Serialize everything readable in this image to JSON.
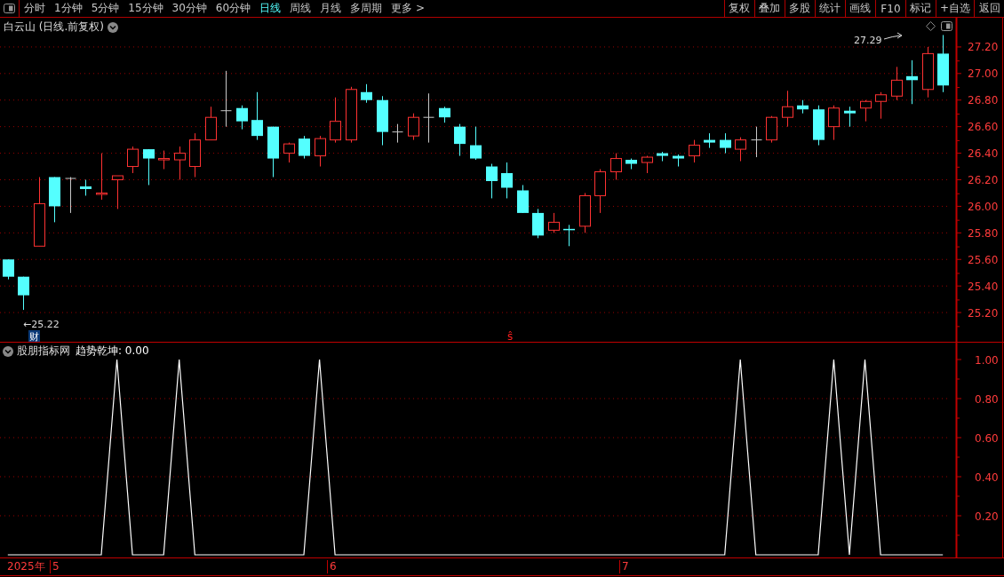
{
  "toolbar": {
    "periods": [
      {
        "label": "分时",
        "selected": false
      },
      {
        "label": "1分钟",
        "selected": false
      },
      {
        "label": "5分钟",
        "selected": false
      },
      {
        "label": "15分钟",
        "selected": false
      },
      {
        "label": "30分钟",
        "selected": false
      },
      {
        "label": "60分钟",
        "selected": false
      },
      {
        "label": "日线",
        "selected": true
      },
      {
        "label": "周线",
        "selected": false
      },
      {
        "label": "月线",
        "selected": false
      },
      {
        "label": "多周期",
        "selected": false
      },
      {
        "label": "更多 >",
        "selected": false
      }
    ],
    "buttons": [
      "复权",
      "叠加",
      "多股",
      "统计",
      "画线",
      "F10",
      "标记",
      "+自选",
      "返回"
    ]
  },
  "price_pane": {
    "title": "白云山 (日线.前复权)",
    "high_marker": "27.29",
    "low_marker": "←25.22",
    "finance_badge": "财",
    "signal_mark": "ŝ",
    "chart_data": {
      "type": "candlestick",
      "grid": true,
      "categories": [
        null,
        null,
        null,
        null,
        null,
        null,
        null,
        null,
        null,
        null,
        null,
        null,
        null,
        null,
        null,
        null,
        null,
        null,
        null,
        null,
        null,
        null,
        null,
        null,
        null,
        null,
        null,
        null,
        null,
        null,
        null,
        null,
        null,
        null,
        null,
        null,
        null,
        null,
        null,
        null,
        null,
        null,
        null,
        null,
        null,
        null,
        null,
        null,
        null,
        null,
        null,
        null,
        null,
        null,
        null,
        null,
        null,
        null,
        null,
        null,
        null
      ],
      "ylim": [
        24.98,
        27.42
      ],
      "yticks": [
        {
          "value": 27.2,
          "label": "27.20"
        },
        {
          "value": 27.0,
          "label": "27.00"
        },
        {
          "value": 26.8,
          "label": "26.80"
        },
        {
          "value": 26.6,
          "label": "26.60"
        },
        {
          "value": 26.4,
          "label": "26.40"
        },
        {
          "value": 26.2,
          "label": "26.20"
        },
        {
          "value": 26.0,
          "label": "26.00"
        },
        {
          "value": 25.8,
          "label": "25.80"
        },
        {
          "value": 25.6,
          "label": "25.60"
        },
        {
          "value": 25.4,
          "label": "25.40"
        },
        {
          "value": 25.2,
          "label": "25.20"
        }
      ],
      "ohlc": [
        [
          25.6,
          25.6,
          25.45,
          25.47
        ],
        [
          25.47,
          25.47,
          25.22,
          25.33
        ],
        [
          25.7,
          26.22,
          25.7,
          26.02
        ],
        [
          26.22,
          26.22,
          25.88,
          26.0
        ],
        [
          26.21,
          26.22,
          25.95,
          26.21
        ],
        [
          26.15,
          26.2,
          26.08,
          26.13
        ],
        [
          26.09,
          26.4,
          26.05,
          26.1
        ],
        [
          26.2,
          26.23,
          25.98,
          26.23
        ],
        [
          26.3,
          26.45,
          26.25,
          26.43
        ],
        [
          26.43,
          26.43,
          26.16,
          26.36
        ],
        [
          26.35,
          26.42,
          26.28,
          26.36
        ],
        [
          26.35,
          26.45,
          26.2,
          26.4
        ],
        [
          26.3,
          26.55,
          26.22,
          26.5
        ],
        [
          26.5,
          26.75,
          26.5,
          26.67
        ],
        [
          26.72,
          27.02,
          26.6,
          26.72
        ],
        [
          26.74,
          26.76,
          26.58,
          26.64
        ],
        [
          26.65,
          26.86,
          26.5,
          26.53
        ],
        [
          26.6,
          26.6,
          26.22,
          26.36
        ],
        [
          26.4,
          26.48,
          26.33,
          26.47
        ],
        [
          26.51,
          26.53,
          26.36,
          26.38
        ],
        [
          26.38,
          26.53,
          26.3,
          26.51
        ],
        [
          26.5,
          26.82,
          26.48,
          26.64
        ],
        [
          26.5,
          26.9,
          26.48,
          26.88
        ],
        [
          26.86,
          26.92,
          26.78,
          26.8
        ],
        [
          26.8,
          26.83,
          26.46,
          26.56
        ],
        [
          26.56,
          26.62,
          26.48,
          26.56
        ],
        [
          26.53,
          26.7,
          26.5,
          26.67
        ],
        [
          26.67,
          26.85,
          26.48,
          26.67
        ],
        [
          26.74,
          26.75,
          26.63,
          26.67
        ],
        [
          26.6,
          26.62,
          26.38,
          26.47
        ],
        [
          26.46,
          26.6,
          26.35,
          26.36
        ],
        [
          26.3,
          26.32,
          26.06,
          26.19
        ],
        [
          26.25,
          26.33,
          26.06,
          26.14
        ],
        [
          26.12,
          26.16,
          25.95,
          25.95
        ],
        [
          25.95,
          25.98,
          25.76,
          25.78
        ],
        [
          25.82,
          25.95,
          25.8,
          25.88
        ],
        [
          25.83,
          25.86,
          25.7,
          25.82
        ],
        [
          25.85,
          26.1,
          25.8,
          26.08
        ],
        [
          26.08,
          26.28,
          25.95,
          26.26
        ],
        [
          26.26,
          26.4,
          26.2,
          26.36
        ],
        [
          26.35,
          26.36,
          26.28,
          26.32
        ],
        [
          26.33,
          26.38,
          26.25,
          26.37
        ],
        [
          26.4,
          26.41,
          26.34,
          26.38
        ],
        [
          26.38,
          26.39,
          26.3,
          26.36
        ],
        [
          26.38,
          26.5,
          26.33,
          26.46
        ],
        [
          26.5,
          26.55,
          26.44,
          26.48
        ],
        [
          26.5,
          26.55,
          26.4,
          26.44
        ],
        [
          26.43,
          26.52,
          26.34,
          26.5
        ],
        [
          26.5,
          26.6,
          26.37,
          26.5
        ],
        [
          26.5,
          26.68,
          26.48,
          26.67
        ],
        [
          26.67,
          26.87,
          26.6,
          26.75
        ],
        [
          26.76,
          26.8,
          26.7,
          26.73
        ],
        [
          26.73,
          26.76,
          26.46,
          26.5
        ],
        [
          26.6,
          26.76,
          26.5,
          26.74
        ],
        [
          26.72,
          26.75,
          26.6,
          26.7
        ],
        [
          26.74,
          26.8,
          26.64,
          26.79
        ],
        [
          26.79,
          26.86,
          26.66,
          26.84
        ],
        [
          26.83,
          27.05,
          26.8,
          26.95
        ],
        [
          26.98,
          27.1,
          26.77,
          26.95
        ],
        [
          26.88,
          27.2,
          26.82,
          27.15
        ],
        [
          27.15,
          27.29,
          26.86,
          26.91
        ]
      ]
    }
  },
  "indicator_pane": {
    "name": "股朋指标网",
    "reading": ": 0.00",
    "chart_data": {
      "type": "line",
      "grid": true,
      "categories": [
        null,
        null,
        null,
        null,
        null,
        null,
        null,
        null,
        null,
        null,
        null,
        null,
        null,
        null,
        null,
        null,
        null,
        null,
        null,
        null,
        null,
        null,
        null,
        null,
        null,
        null,
        null,
        null,
        null,
        null,
        null,
        null,
        null,
        null,
        null,
        null,
        null,
        null,
        null,
        null,
        null,
        null,
        null,
        null,
        null,
        null,
        null,
        null,
        null,
        null,
        null,
        null,
        null,
        null,
        null,
        null,
        null,
        null,
        null,
        null,
        null
      ],
      "ylim": [
        -0.0136,
        1.0864
      ],
      "yticks": [
        {
          "value": 0.2,
          "label": "0.20"
        },
        {
          "value": 0.4,
          "label": "0.40"
        },
        {
          "value": 0.6,
          "label": "0.60"
        },
        {
          "value": 0.8,
          "label": "0.80"
        },
        {
          "value": 1.0,
          "label": "1.00"
        }
      ],
      "series": [
        {
          "name": "趋势乾坤",
          "color": "#ffffff",
          "values": [
            0,
            0,
            0,
            0,
            0,
            0,
            0,
            1,
            0,
            0,
            0,
            1,
            0,
            0,
            0,
            0,
            0,
            0,
            0,
            0,
            1,
            0,
            0,
            0,
            0,
            0,
            0,
            0,
            0,
            0,
            0,
            0,
            0,
            0,
            0,
            0,
            0,
            0,
            0,
            0,
            0,
            0,
            0,
            0,
            0,
            0,
            0,
            1,
            0,
            0,
            0,
            0,
            0,
            1,
            0,
            1,
            0,
            0,
            0,
            0,
            0
          ]
        }
      ]
    }
  },
  "date_axis": {
    "year": "2025年",
    "months": [
      "5",
      "6",
      "7"
    ]
  }
}
